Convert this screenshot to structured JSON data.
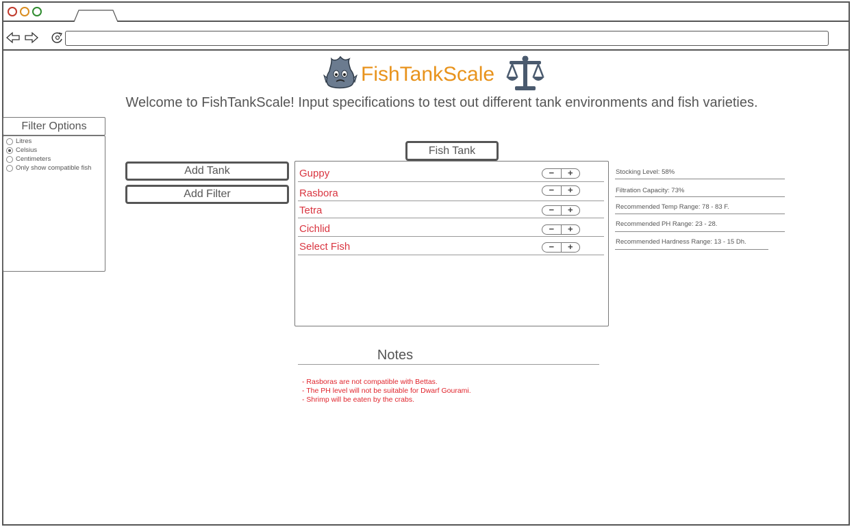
{
  "app": {
    "title": "FishTankScale",
    "welcome": "Welcome to FishTankScale! Input specifications to test out different tank environments and fish varieties.",
    "title_color": "#e8931c"
  },
  "icons": {
    "logo": "fish-icon",
    "scale": "balance-scale-icon",
    "back": "back-arrow-icon",
    "forward": "forward-arrow-icon",
    "reload": "reload-icon"
  },
  "filter": {
    "header": "Filter Options",
    "options": [
      {
        "label": "Litres",
        "checked": false
      },
      {
        "label": "Celsius",
        "checked": true
      },
      {
        "label": "Centimeters",
        "checked": false
      },
      {
        "label": "Only show compatible fish",
        "checked": false
      }
    ]
  },
  "actions": {
    "add_tank": "Add Tank",
    "add_filter": "Add Filter"
  },
  "tank": {
    "title": "Fish Tank",
    "fish": [
      {
        "name": "Guppy"
      },
      {
        "name": "Rasbora"
      },
      {
        "name": "Tetra"
      },
      {
        "name": "Cichlid"
      },
      {
        "name": "Select Fish"
      }
    ],
    "stepper": {
      "minus": "−",
      "plus": "+"
    }
  },
  "stats": [
    "Stocking Level: 58%",
    "Filtration Capacity: 73%",
    "Recommended Temp Range: 78 - 83 F.",
    "Recommended PH Range: 23 - 28.",
    "Recommended Hardness Range: 13 - 15 Dh."
  ],
  "notes": {
    "title": "Notes",
    "items": [
      "- Rasboras are not compatible with Bettas.",
      "- The PH level will not be suitable for Dwarf Gourami.",
      "- Shrimp will be eaten by the crabs."
    ],
    "color": "#e0242c"
  }
}
